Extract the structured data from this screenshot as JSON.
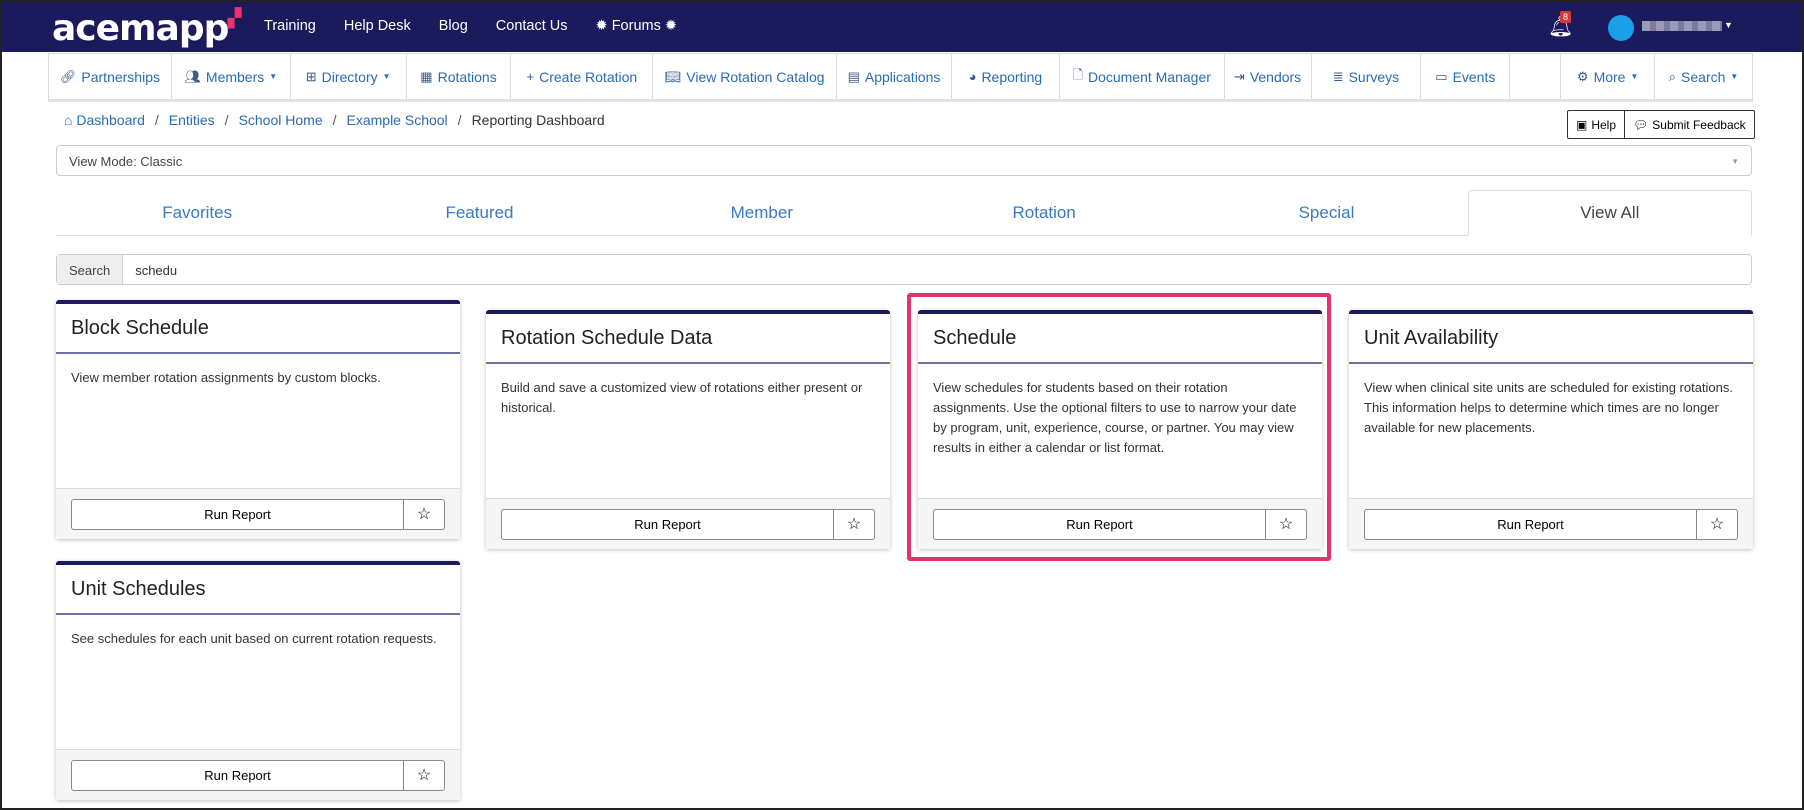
{
  "topbar": {
    "logo": "acemapp",
    "links": [
      "Training",
      "Help Desk",
      "Blog",
      "Contact Us",
      "Forums"
    ],
    "notification_count": "8"
  },
  "nav": [
    {
      "label": "Partnerships",
      "icon": "link-icon"
    },
    {
      "label": "Members",
      "icon": "users-icon",
      "dropdown": true
    },
    {
      "label": "Directory",
      "icon": "sitemap-icon",
      "dropdown": true
    },
    {
      "label": "Rotations",
      "icon": "table-icon"
    },
    {
      "label": "Create Rotation",
      "icon": "plus-icon"
    },
    {
      "label": "View Rotation Catalog",
      "icon": "book-icon"
    },
    {
      "label": "Applications",
      "icon": "id-card-icon"
    },
    {
      "label": "Reporting",
      "icon": "dashboard-icon"
    },
    {
      "label": "Document Manager",
      "icon": "file-icon"
    },
    {
      "label": "Vendors",
      "icon": "sign-in-icon"
    },
    {
      "label": "Surveys",
      "icon": "list-icon"
    },
    {
      "label": "Events",
      "icon": "calendar-icon"
    },
    {
      "label": "More",
      "icon": "gear-icon",
      "dropdown": true
    },
    {
      "label": "Search",
      "icon": "search-icon",
      "dropdown": true
    }
  ],
  "breadcrumb": [
    "Dashboard",
    "Entities",
    "School Home",
    "Example School",
    "Reporting Dashboard"
  ],
  "help": {
    "help_label": "Help",
    "feedback_label": "Submit Feedback"
  },
  "view_mode": "View Mode: Classic",
  "tabs": [
    "Favorites",
    "Featured",
    "Member",
    "Rotation",
    "Special",
    "View All"
  ],
  "active_tab": "View All",
  "search": {
    "label": "Search",
    "value": "schedu"
  },
  "cards": [
    {
      "title": "Block Schedule",
      "description": "View member rotation assignments by custom blocks.",
      "button": "Run Report"
    },
    {
      "title": "Rotation Schedule Data",
      "description": "Build and save a customized view of rotations either present or historical.",
      "button": "Run Report"
    },
    {
      "title": "Schedule",
      "description": "View schedules for students based on their rotation assignments. Use the optional filters to use to narrow your date by program, unit, experience, course, or partner. You may view results in either a calendar or list format.",
      "button": "Run Report",
      "highlighted": true
    },
    {
      "title": "Unit Availability",
      "description": "View when clinical site units are scheduled for existing rotations. This information helps to determine which times are no longer available for new placements.",
      "button": "Run Report"
    },
    {
      "title": "Unit Schedules",
      "description": "See schedules for each unit based on current rotation requests.",
      "button": "Run Report"
    }
  ],
  "colors": {
    "topbar": "#1a1a5c",
    "link": "#2a6bb5",
    "highlight": "#e5336a"
  }
}
